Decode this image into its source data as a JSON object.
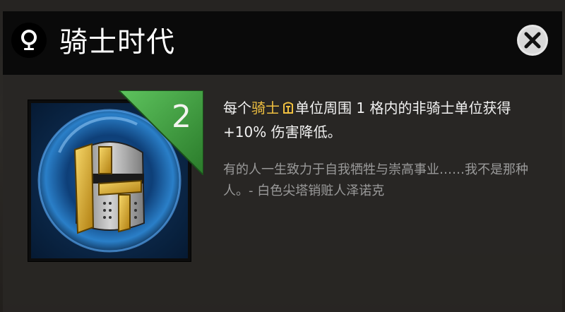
{
  "header": {
    "title": "骑士时代",
    "title_icon": "lightbulb-icon",
    "close_icon": "close-icon"
  },
  "item": {
    "icon": "knight-helmet-icon",
    "level_badge": "2"
  },
  "description": {
    "prefix": "每个",
    "highlight": "骑士",
    "highlight_icon": "knight-helmet-small-icon",
    "suffix": "单位周围 1 格内的非骑士单位获得 +10% 伤害降低。"
  },
  "flavor_text": "有的人一生致力于自我牺牲与崇高事业……我不是那种人。- 白色尖塔销赃人泽诺克",
  "colors": {
    "highlight": "#f0c040",
    "badge_green": "#3a8a3a",
    "header_bg": "#0a0a0a",
    "panel_bg": "#282624",
    "flavor": "#9a9a9a"
  }
}
